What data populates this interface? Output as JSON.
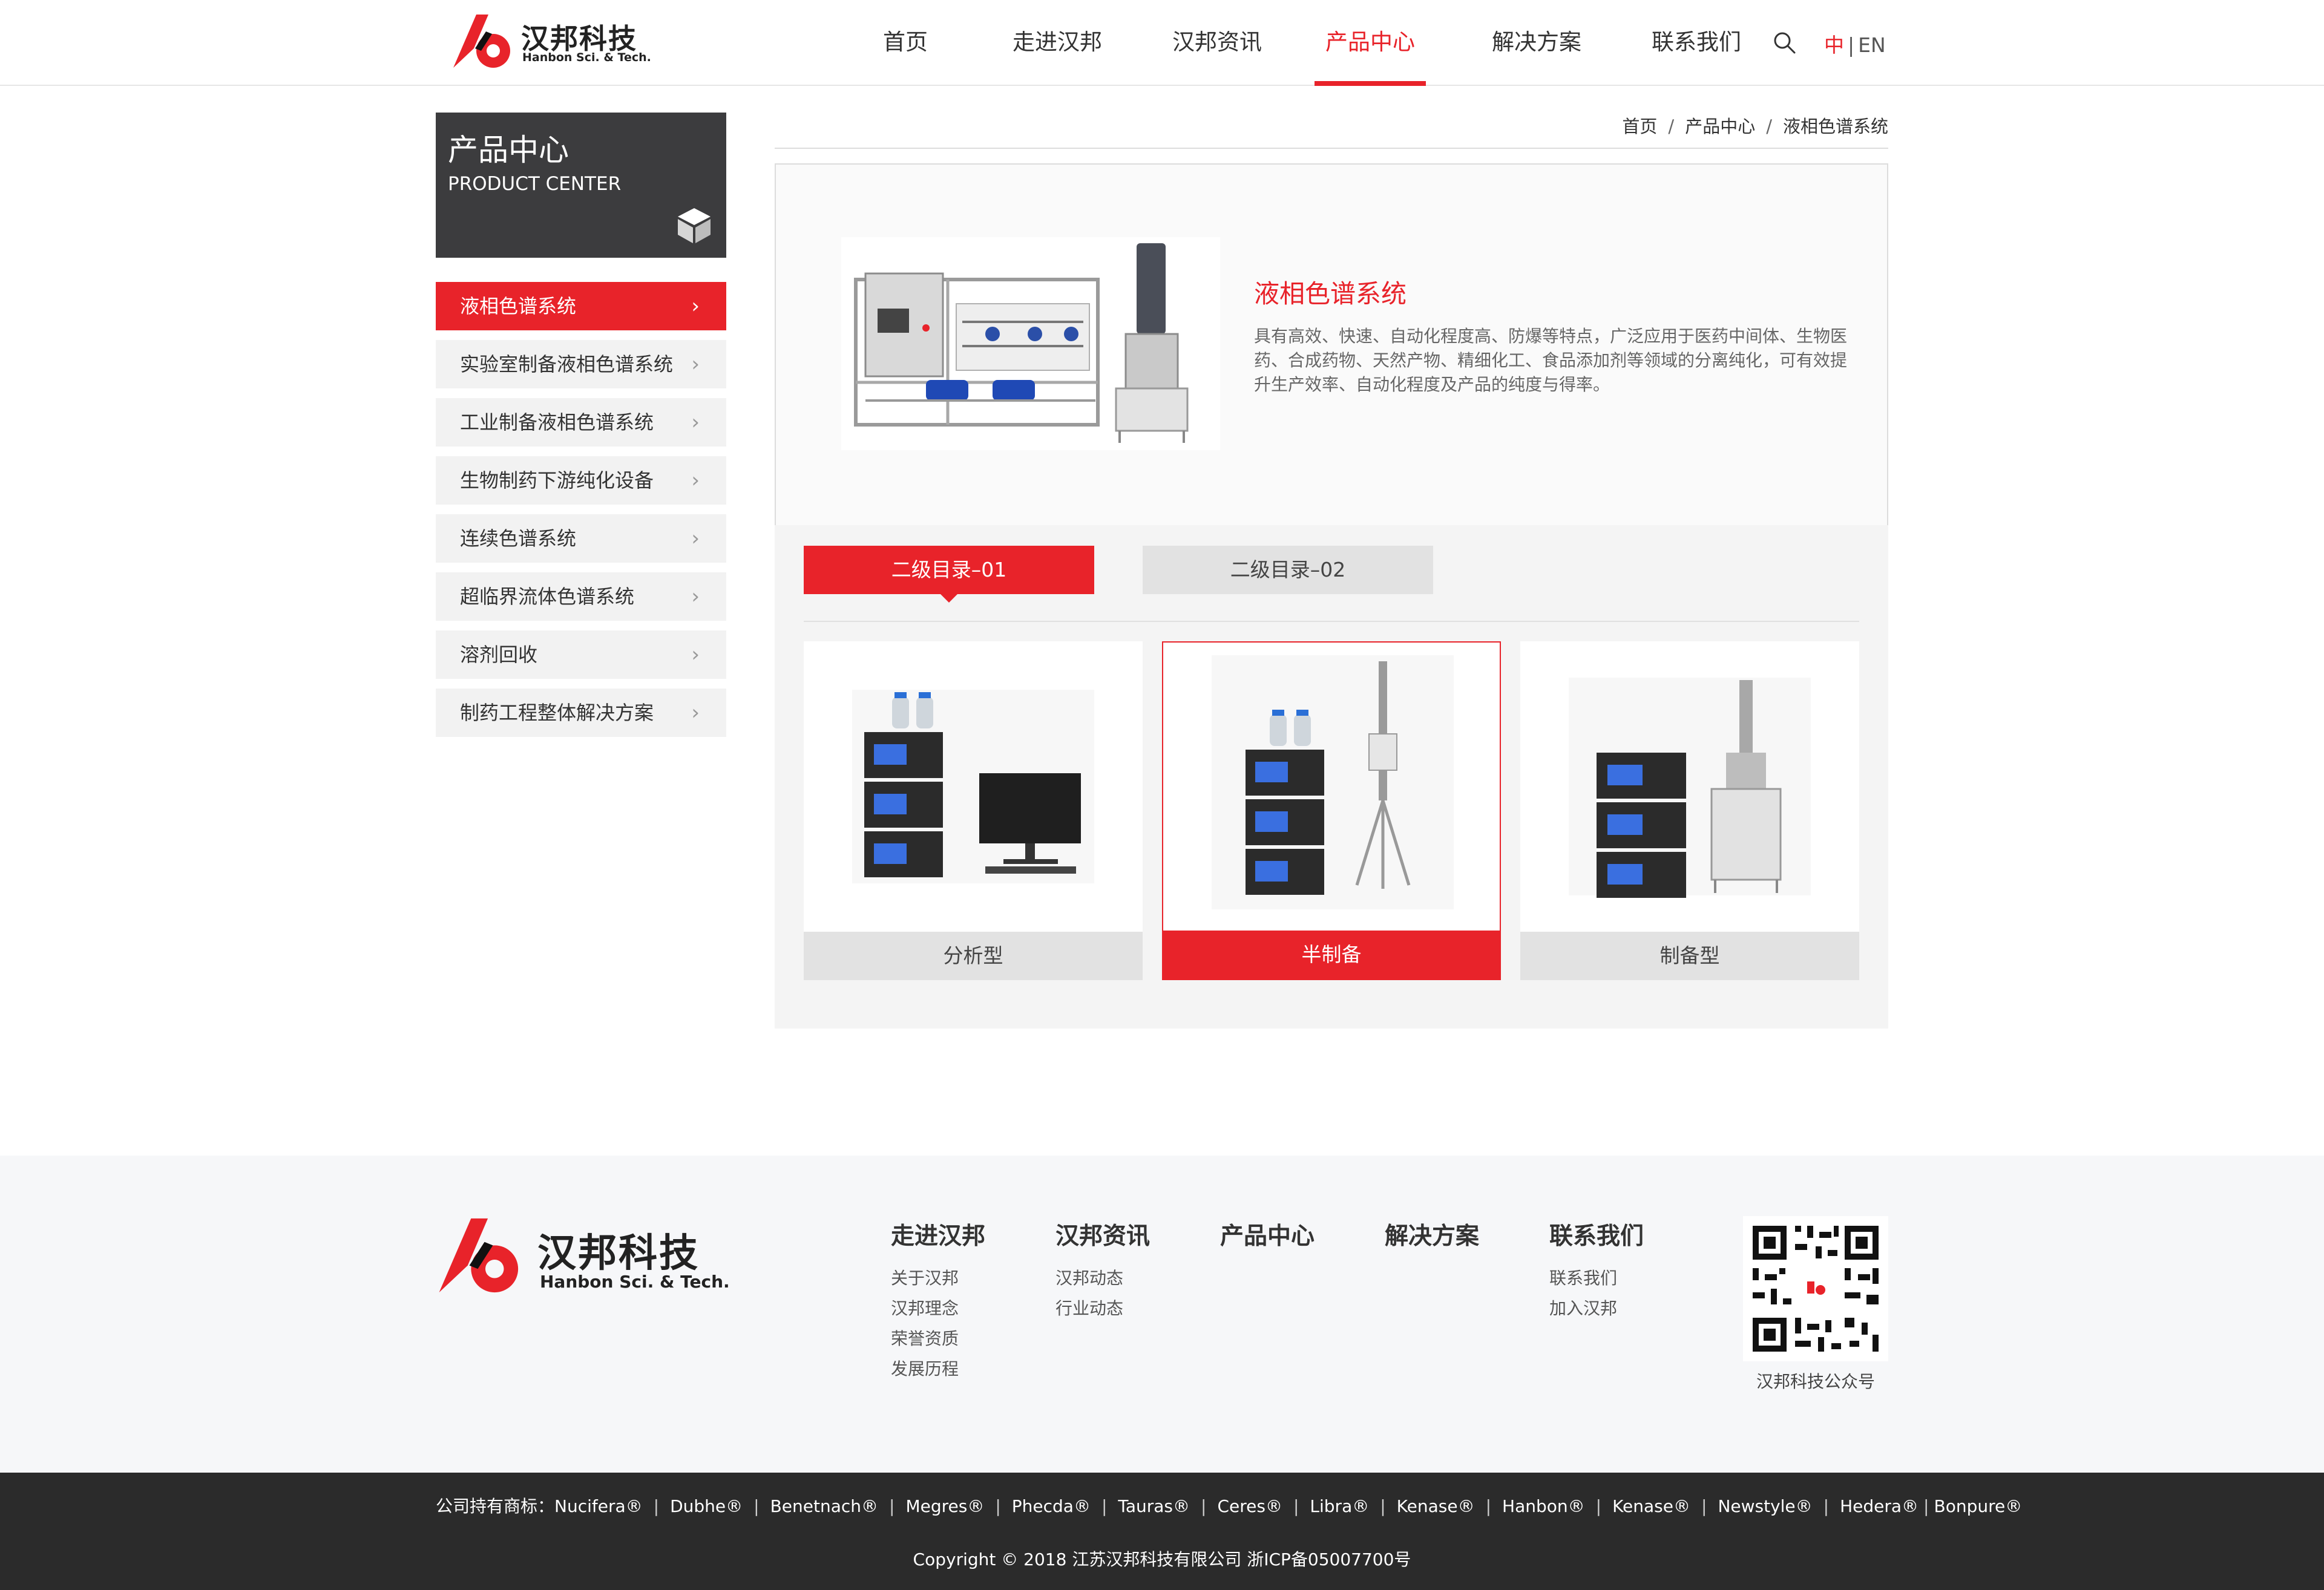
{
  "header": {
    "logo_cn": "汉邦科技",
    "logo_en": "Hanbon Sci. & Tech.",
    "nav": [
      {
        "label": "首页"
      },
      {
        "label": "走进汉邦"
      },
      {
        "label": "汉邦资讯"
      },
      {
        "label": "产品中心"
      },
      {
        "label": "解决方案"
      },
      {
        "label": "联系我们"
      }
    ],
    "lang_zh": "中",
    "lang_sep": "|",
    "lang_en": "EN"
  },
  "sidebar": {
    "title_cn": "产品中心",
    "title_en": "PRODUCT CENTER",
    "items": [
      {
        "label": "液相色谱系统"
      },
      {
        "label": "实验室制备液相色谱系统"
      },
      {
        "label": "工业制备液相色谱系统"
      },
      {
        "label": "生物制药下游纯化设备"
      },
      {
        "label": "连续色谱系统"
      },
      {
        "label": "超临界流体色谱系统"
      },
      {
        "label": "溶剂回收"
      },
      {
        "label": "制药工程整体解决方案"
      }
    ]
  },
  "breadcrumb": [
    "首页",
    "产品中心",
    "液相色谱系统"
  ],
  "intro": {
    "title": "液相色谱系统",
    "description": "具有高效、快速、自动化程度高、防爆等特点，广泛应用于医药中间体、生物医药、合成药物、天然产物、精细化工、食品添加剂等领域的分离纯化，可有效提升生产效率、自动化程度及产品的纯度与得率。"
  },
  "tabs": [
    {
      "label": "二级目录–01"
    },
    {
      "label": "二级目录–02"
    }
  ],
  "cards": [
    {
      "label": "分析型"
    },
    {
      "label": "半制备"
    },
    {
      "label": "制备型"
    }
  ],
  "footer": {
    "logo_cn": "汉邦科技",
    "logo_en": "Hanbon Sci. & Tech.",
    "columns": [
      {
        "heading": "走进汉邦",
        "links": [
          "关于汉邦",
          "汉邦理念",
          "荣誉资质",
          "发展历程"
        ]
      },
      {
        "heading": "汉邦资讯",
        "links": [
          "汉邦动态",
          "行业动态"
        ]
      },
      {
        "heading": "产品中心",
        "links": []
      },
      {
        "heading": "解决方案",
        "links": []
      },
      {
        "heading": "联系我们",
        "links": [
          "联系我们",
          "加入汉邦"
        ]
      }
    ],
    "qr_caption": "汉邦科技公众号",
    "trademark_prefix": "公司持有商标：",
    "trademarks": [
      "Nucifera®",
      "Dubhe®",
      "Benetnach®",
      "Megres®",
      "Phecda®",
      "Tauras®",
      "Ceres®",
      "Libra®",
      "Kenase®",
      "Hanbon®",
      "Kenase®",
      "Newstyle®",
      "Hedera®",
      "Bonpure®"
    ],
    "copyright": "Copyright © 2018 江苏汉邦科技有限公司 浙ICP备05007700号"
  },
  "colors": {
    "accent": "#e8232a",
    "sidebar_head": "#3c3c3e",
    "footer_bottom": "#2b2b2b"
  },
  "icons": {
    "search": "search-icon",
    "cube": "cube-icon",
    "chevron": "chevron-right-icon"
  }
}
